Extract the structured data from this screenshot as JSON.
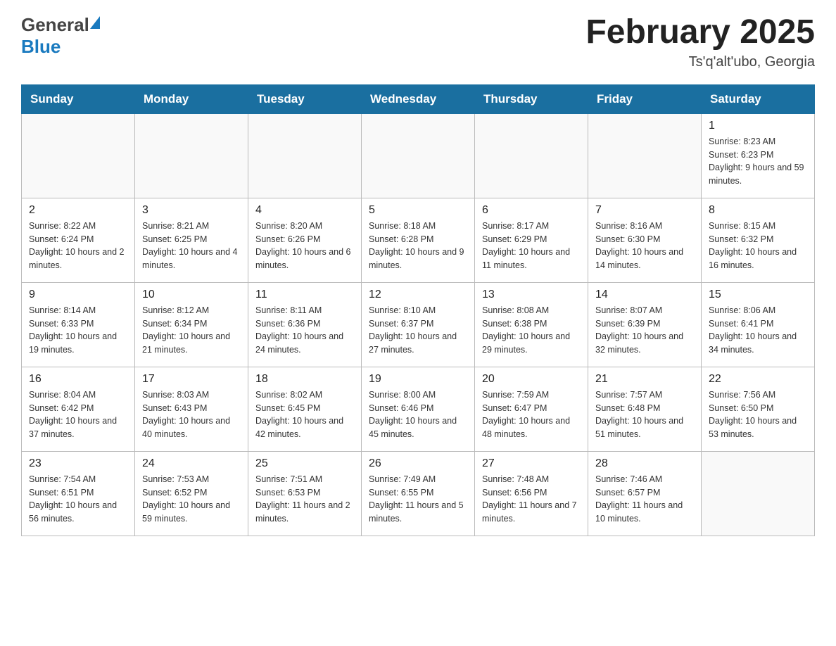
{
  "header": {
    "logo_general": "General",
    "logo_blue": "Blue",
    "month_title": "February 2025",
    "location": "Ts'q'alt'ubo, Georgia"
  },
  "weekdays": [
    "Sunday",
    "Monday",
    "Tuesday",
    "Wednesday",
    "Thursday",
    "Friday",
    "Saturday"
  ],
  "weeks": [
    [
      {
        "day": "",
        "info": ""
      },
      {
        "day": "",
        "info": ""
      },
      {
        "day": "",
        "info": ""
      },
      {
        "day": "",
        "info": ""
      },
      {
        "day": "",
        "info": ""
      },
      {
        "day": "",
        "info": ""
      },
      {
        "day": "1",
        "info": "Sunrise: 8:23 AM\nSunset: 6:23 PM\nDaylight: 9 hours and 59 minutes."
      }
    ],
    [
      {
        "day": "2",
        "info": "Sunrise: 8:22 AM\nSunset: 6:24 PM\nDaylight: 10 hours and 2 minutes."
      },
      {
        "day": "3",
        "info": "Sunrise: 8:21 AM\nSunset: 6:25 PM\nDaylight: 10 hours and 4 minutes."
      },
      {
        "day": "4",
        "info": "Sunrise: 8:20 AM\nSunset: 6:26 PM\nDaylight: 10 hours and 6 minutes."
      },
      {
        "day": "5",
        "info": "Sunrise: 8:18 AM\nSunset: 6:28 PM\nDaylight: 10 hours and 9 minutes."
      },
      {
        "day": "6",
        "info": "Sunrise: 8:17 AM\nSunset: 6:29 PM\nDaylight: 10 hours and 11 minutes."
      },
      {
        "day": "7",
        "info": "Sunrise: 8:16 AM\nSunset: 6:30 PM\nDaylight: 10 hours and 14 minutes."
      },
      {
        "day": "8",
        "info": "Sunrise: 8:15 AM\nSunset: 6:32 PM\nDaylight: 10 hours and 16 minutes."
      }
    ],
    [
      {
        "day": "9",
        "info": "Sunrise: 8:14 AM\nSunset: 6:33 PM\nDaylight: 10 hours and 19 minutes."
      },
      {
        "day": "10",
        "info": "Sunrise: 8:12 AM\nSunset: 6:34 PM\nDaylight: 10 hours and 21 minutes."
      },
      {
        "day": "11",
        "info": "Sunrise: 8:11 AM\nSunset: 6:36 PM\nDaylight: 10 hours and 24 minutes."
      },
      {
        "day": "12",
        "info": "Sunrise: 8:10 AM\nSunset: 6:37 PM\nDaylight: 10 hours and 27 minutes."
      },
      {
        "day": "13",
        "info": "Sunrise: 8:08 AM\nSunset: 6:38 PM\nDaylight: 10 hours and 29 minutes."
      },
      {
        "day": "14",
        "info": "Sunrise: 8:07 AM\nSunset: 6:39 PM\nDaylight: 10 hours and 32 minutes."
      },
      {
        "day": "15",
        "info": "Sunrise: 8:06 AM\nSunset: 6:41 PM\nDaylight: 10 hours and 34 minutes."
      }
    ],
    [
      {
        "day": "16",
        "info": "Sunrise: 8:04 AM\nSunset: 6:42 PM\nDaylight: 10 hours and 37 minutes."
      },
      {
        "day": "17",
        "info": "Sunrise: 8:03 AM\nSunset: 6:43 PM\nDaylight: 10 hours and 40 minutes."
      },
      {
        "day": "18",
        "info": "Sunrise: 8:02 AM\nSunset: 6:45 PM\nDaylight: 10 hours and 42 minutes."
      },
      {
        "day": "19",
        "info": "Sunrise: 8:00 AM\nSunset: 6:46 PM\nDaylight: 10 hours and 45 minutes."
      },
      {
        "day": "20",
        "info": "Sunrise: 7:59 AM\nSunset: 6:47 PM\nDaylight: 10 hours and 48 minutes."
      },
      {
        "day": "21",
        "info": "Sunrise: 7:57 AM\nSunset: 6:48 PM\nDaylight: 10 hours and 51 minutes."
      },
      {
        "day": "22",
        "info": "Sunrise: 7:56 AM\nSunset: 6:50 PM\nDaylight: 10 hours and 53 minutes."
      }
    ],
    [
      {
        "day": "23",
        "info": "Sunrise: 7:54 AM\nSunset: 6:51 PM\nDaylight: 10 hours and 56 minutes."
      },
      {
        "day": "24",
        "info": "Sunrise: 7:53 AM\nSunset: 6:52 PM\nDaylight: 10 hours and 59 minutes."
      },
      {
        "day": "25",
        "info": "Sunrise: 7:51 AM\nSunset: 6:53 PM\nDaylight: 11 hours and 2 minutes."
      },
      {
        "day": "26",
        "info": "Sunrise: 7:49 AM\nSunset: 6:55 PM\nDaylight: 11 hours and 5 minutes."
      },
      {
        "day": "27",
        "info": "Sunrise: 7:48 AM\nSunset: 6:56 PM\nDaylight: 11 hours and 7 minutes."
      },
      {
        "day": "28",
        "info": "Sunrise: 7:46 AM\nSunset: 6:57 PM\nDaylight: 11 hours and 10 minutes."
      },
      {
        "day": "",
        "info": ""
      }
    ]
  ]
}
